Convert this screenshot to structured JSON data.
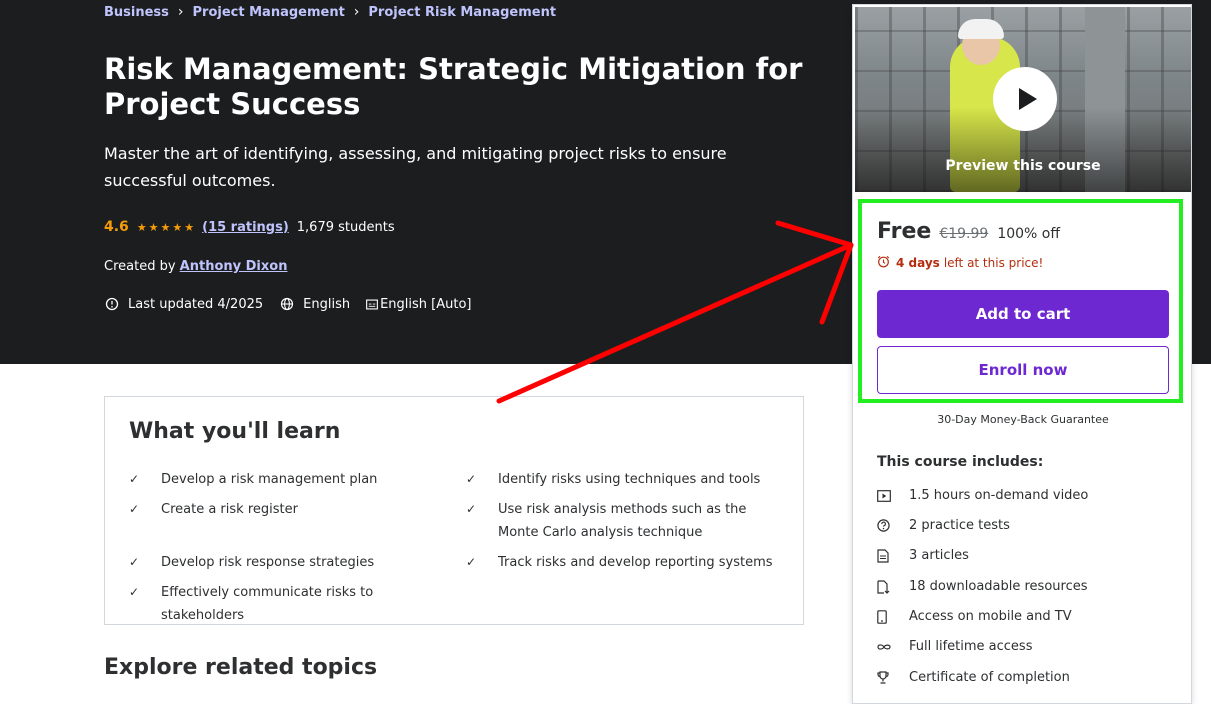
{
  "breadcrumb": [
    "Business",
    "Project Management",
    "Project Risk Management"
  ],
  "course": {
    "title": "Risk Management: Strategic Mitigation for Project Success",
    "subtitle": "Master the art of identifying, assessing, and mitigating project risks to ensure successful outcomes.",
    "rating": "4.6",
    "stars": "★★★★★",
    "ratings_link": "(15 ratings)",
    "students": "1,679 students",
    "created_by_label": "Created by",
    "author": "Anthony Dixon",
    "last_updated": "Last updated 4/2025",
    "language": "English",
    "captions": "English [Auto]"
  },
  "learn": {
    "title": "What you'll learn",
    "items_left": [
      "Develop a risk management plan",
      "Create a risk register",
      "Develop risk response strategies",
      "Effectively communicate risks to stakeholders"
    ],
    "items_right": [
      "Identify risks using techniques and tools",
      "Use risk analysis methods such as the Monte Carlo analysis technique",
      "Track risks and develop reporting systems"
    ]
  },
  "explore_title": "Explore related topics",
  "sidebar": {
    "preview_label": "Preview this course",
    "price_now": "Free",
    "price_old": "€19.99",
    "discount": "100% off",
    "timer_days": "4 days",
    "timer_text": "left at this price!",
    "add_to_cart": "Add to cart",
    "enroll_now": "Enroll now",
    "guarantee": "30-Day Money-Back Guarantee",
    "includes_title": "This course includes:",
    "includes": [
      {
        "icon": "video-icon",
        "label": "1.5 hours on-demand video"
      },
      {
        "icon": "question-icon",
        "label": "2 practice tests"
      },
      {
        "icon": "article-icon",
        "label": "3 articles"
      },
      {
        "icon": "download-icon",
        "label": "18 downloadable resources"
      },
      {
        "icon": "mobile-icon",
        "label": "Access on mobile and TV"
      },
      {
        "icon": "infinity-icon",
        "label": "Full lifetime access"
      },
      {
        "icon": "trophy-icon",
        "label": "Certificate of completion"
      }
    ]
  },
  "colors": {
    "hero_bg": "#1c1d1f",
    "accent_purple": "#6d28d2",
    "link_lavender": "#c0c4fc",
    "star_orange": "#f69c08",
    "timer_red": "#b32d0f",
    "highlight_green": "#22ee22",
    "annotation_red": "#ff0000"
  }
}
